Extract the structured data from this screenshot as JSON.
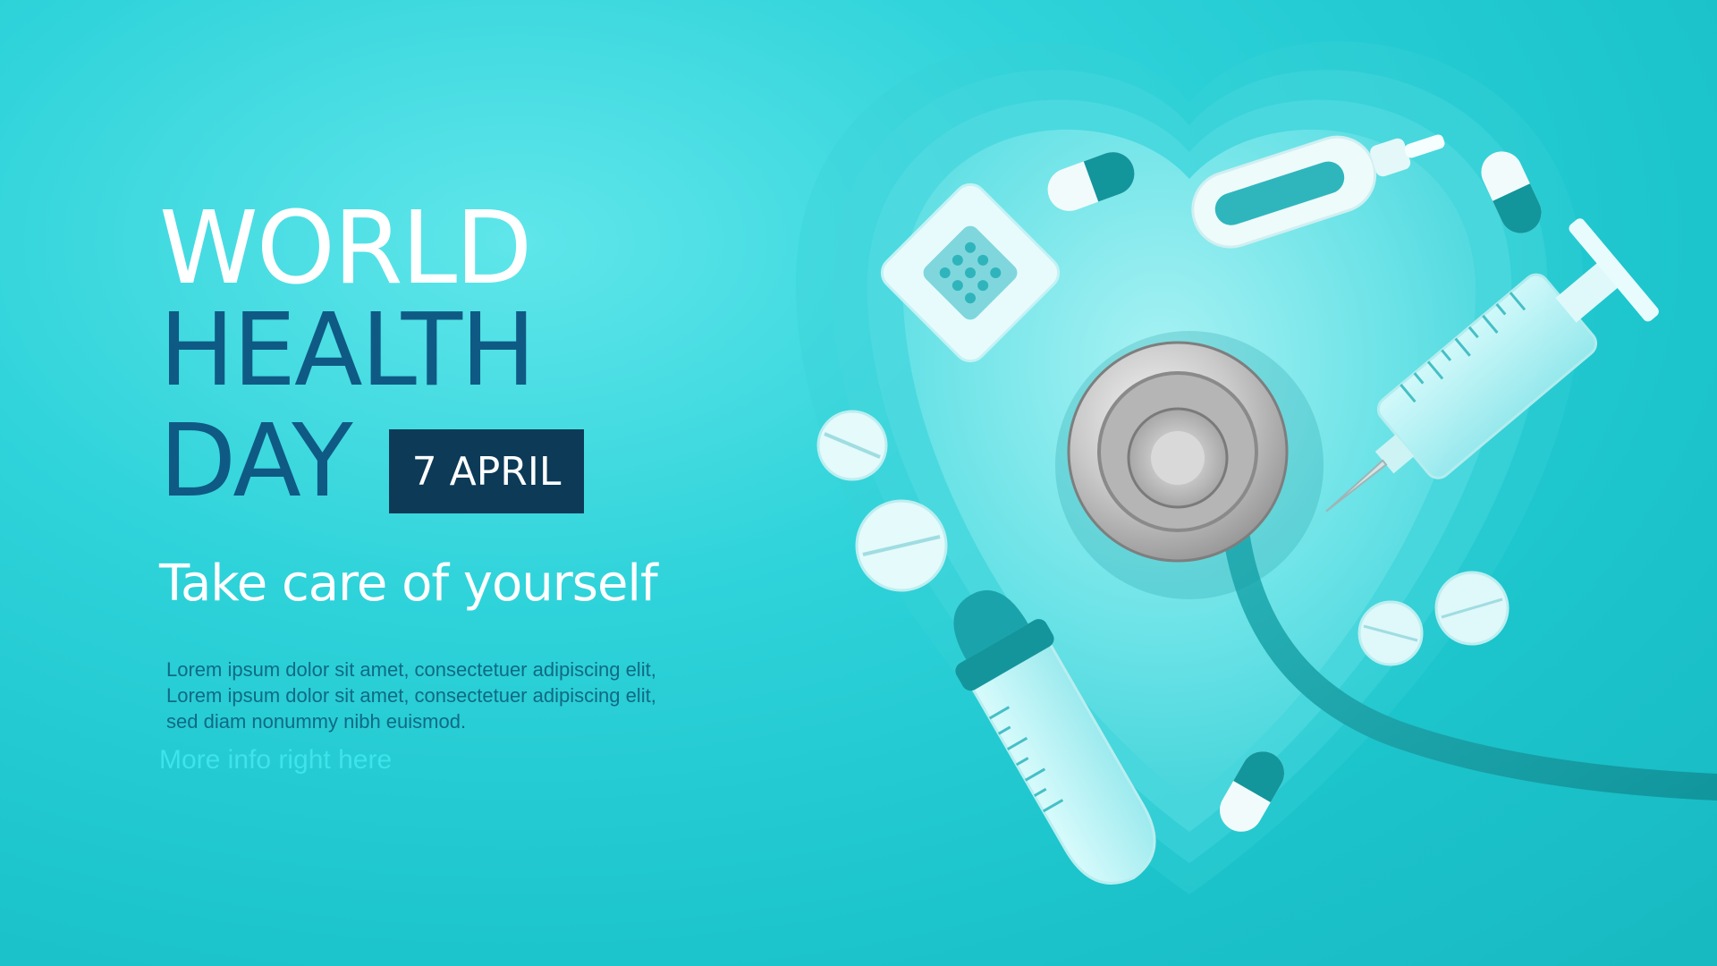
{
  "title": {
    "line1": "WORLD",
    "line2": "HEALTH",
    "line3": "DAY"
  },
  "date_badge": "7 APRIL",
  "subtitle": "Take care of yourself",
  "body_text": "Lorem ipsum dolor sit amet, consectetuer adipiscing elit, Lorem ipsum dolor sit amet, consectetuer adipiscing elit, sed diam nonummy nibh euismod.",
  "link_text": "More info right here",
  "colors": {
    "background": "#1cc4cc",
    "title_white": "#ffffff",
    "title_navy": "#0f5a85",
    "badge_bg": "#0c3a57",
    "accent_teal": "#0e8f98"
  },
  "illustration": {
    "items": [
      "heart-shape",
      "stethoscope-icon",
      "adhesive-bandage-icon",
      "capsule-icon",
      "thermometer-icon",
      "syringe-icon",
      "tablet-icon",
      "test-tube-icon"
    ]
  }
}
